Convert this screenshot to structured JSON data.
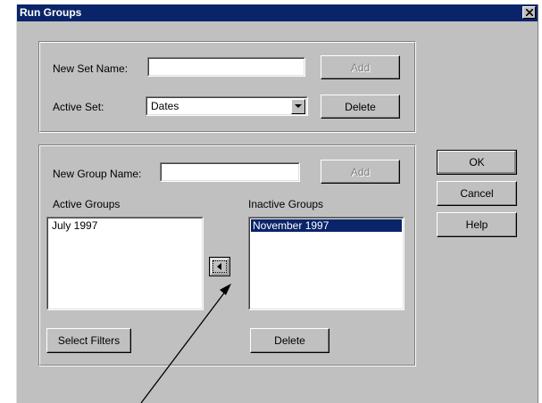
{
  "window": {
    "title": "Run Groups"
  },
  "set_panel": {
    "new_set_label": "New Set Name:",
    "new_set_value": "",
    "add_label": "Add",
    "active_set_label": "Active Set:",
    "active_set_value": "Dates",
    "delete_label": "Delete"
  },
  "group_panel": {
    "new_group_label": "New Group Name:",
    "new_group_value": "",
    "add_label": "Add",
    "active_groups_label": "Active Groups",
    "active_groups": [
      "July 1997"
    ],
    "inactive_groups_label": "Inactive Groups",
    "inactive_groups": [
      "November 1997"
    ],
    "select_filters_label": "Select Filters",
    "delete_label": "Delete"
  },
  "side_buttons": {
    "ok": "OK",
    "cancel": "Cancel",
    "help": "Help"
  },
  "icons": {
    "close": "close-icon",
    "dropdown": "chevron-down-icon",
    "move": "arrow-left-icon"
  },
  "colors": {
    "titlebar": "#0a246a",
    "face": "#c0c0c0",
    "selection": "#0a246a"
  }
}
